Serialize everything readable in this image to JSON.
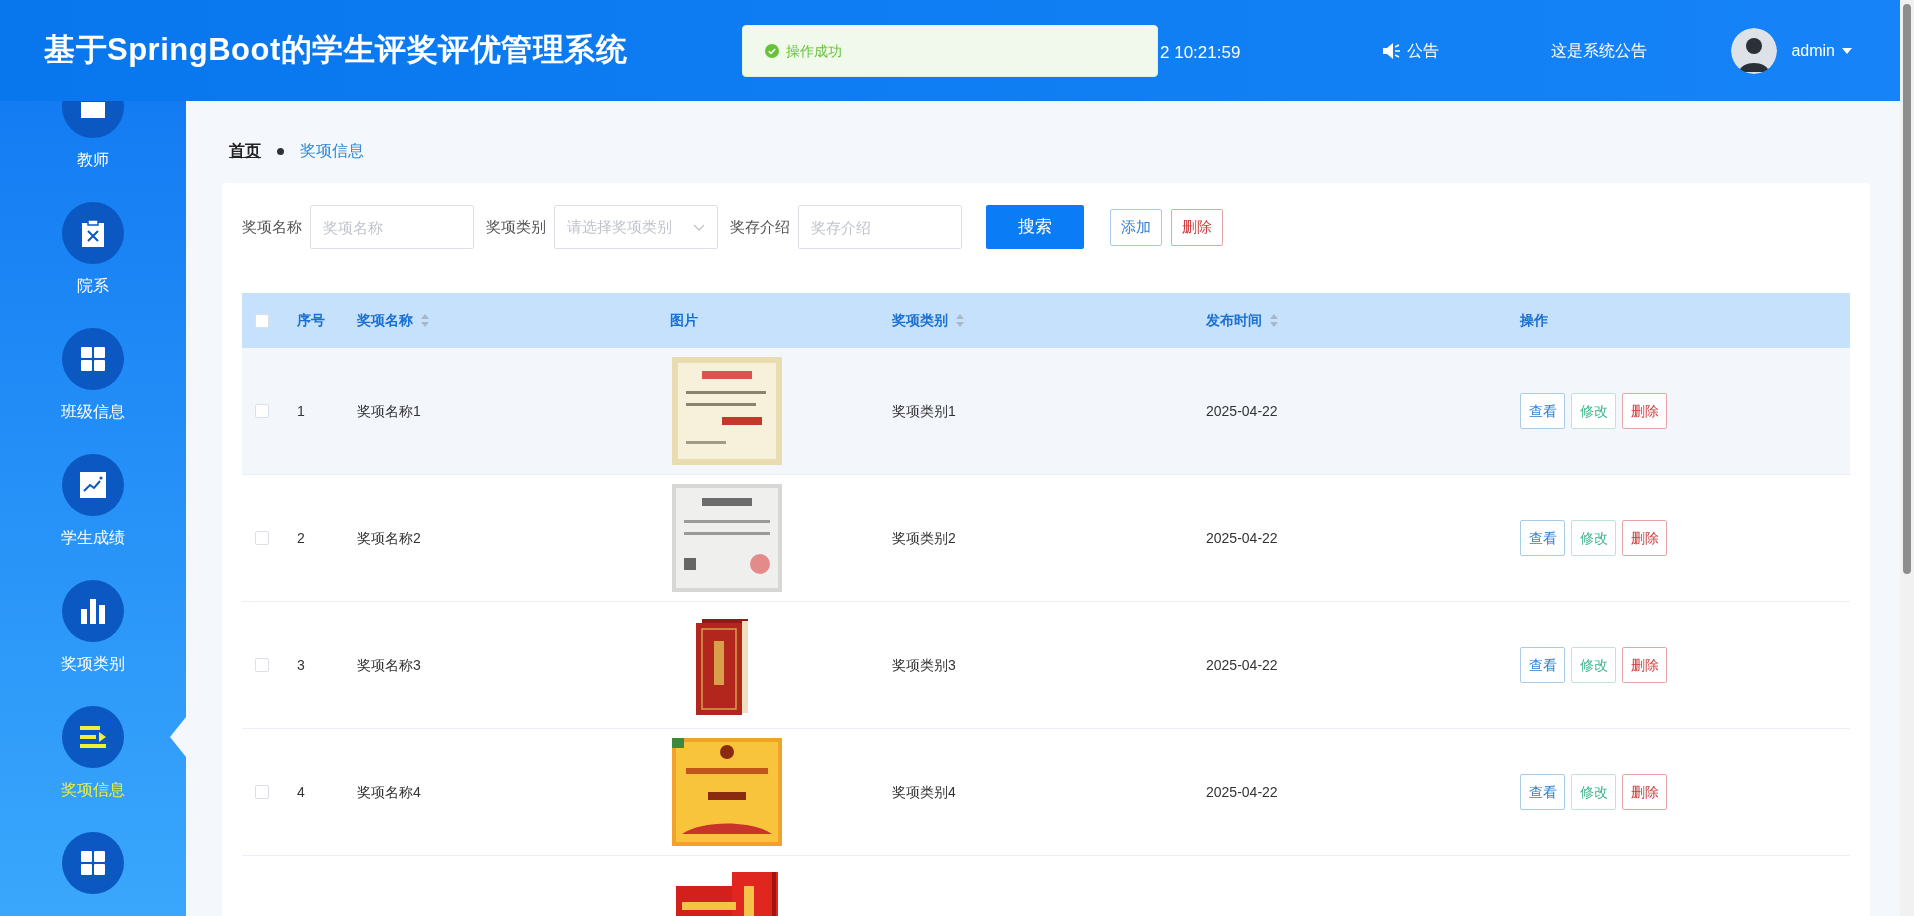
{
  "header": {
    "title": "基于SpringBoot的学生评奖评优管理系统",
    "time": "2 10:21:59",
    "notice_label": "公告",
    "notice_text": "这是系统公告",
    "user": "admin"
  },
  "toast": {
    "message": "操作成功",
    "kind": "success"
  },
  "sidebar": {
    "items": [
      {
        "label": "教师",
        "selected": false
      },
      {
        "label": "院系",
        "selected": false
      },
      {
        "label": "班级信息",
        "selected": false
      },
      {
        "label": "学生成绩",
        "selected": false
      },
      {
        "label": "奖项类别",
        "selected": false
      },
      {
        "label": "奖项信息",
        "selected": true
      },
      {
        "selected": false
      }
    ]
  },
  "breadcrumb": [
    "首页",
    "奖项信息"
  ],
  "search": {
    "fields": [
      {
        "label": "奖项名称",
        "kind": "input",
        "placeholder": "奖项名称"
      },
      {
        "label": "奖项类别",
        "kind": "select",
        "placeholder": "请选择奖项类别"
      },
      {
        "label": "奖存介绍",
        "kind": "input",
        "placeholder": "奖存介绍"
      }
    ],
    "buttons": [
      {
        "label": "搜索",
        "kind": "primary"
      },
      {
        "label": "添加",
        "kind": "add"
      },
      {
        "label": "删除",
        "kind": "delete"
      }
    ]
  },
  "table": {
    "all_checked": false,
    "columns": [
      {
        "label": "序号",
        "sortable": false
      },
      {
        "label": "奖项名称",
        "sortable": true
      },
      {
        "label": "图片",
        "sortable": false
      },
      {
        "label": "奖项类别",
        "sortable": true
      },
      {
        "label": "发布时间",
        "sortable": true
      },
      {
        "label": "操作",
        "sortable": false
      }
    ],
    "rows": [
      {
        "kind": "full",
        "checked": false,
        "hovered": true,
        "index": "1",
        "name": "奖项名称1",
        "category": "奖项类别1",
        "date": "2025-04-22",
        "actions": [
          {
            "label": "查看",
            "kind": "view"
          },
          {
            "label": "修改",
            "kind": "edit"
          },
          {
            "label": "删除",
            "kind": "delete"
          }
        ]
      },
      {
        "kind": "full",
        "checked": false,
        "hovered": false,
        "index": "2",
        "name": "奖项名称2",
        "category": "奖项类别2",
        "date": "2025-04-22",
        "actions": [
          {
            "label": "查看",
            "kind": "view"
          },
          {
            "label": "修改",
            "kind": "edit"
          },
          {
            "label": "删除",
            "kind": "delete"
          }
        ]
      },
      {
        "kind": "full",
        "checked": false,
        "hovered": false,
        "index": "3",
        "name": "奖项名称3",
        "category": "奖项类别3",
        "date": "2025-04-22",
        "actions": [
          {
            "label": "查看",
            "kind": "view"
          },
          {
            "label": "修改",
            "kind": "edit"
          },
          {
            "label": "删除",
            "kind": "delete"
          }
        ]
      },
      {
        "kind": "full",
        "checked": false,
        "hovered": false,
        "index": "4",
        "name": "奖项名称4",
        "category": "奖项类别4",
        "date": "2025-04-22",
        "actions": [
          {
            "label": "查看",
            "kind": "view"
          },
          {
            "label": "修改",
            "kind": "edit"
          },
          {
            "label": "删除",
            "kind": "delete"
          }
        ]
      },
      {
        "kind": "partial"
      }
    ]
  }
}
